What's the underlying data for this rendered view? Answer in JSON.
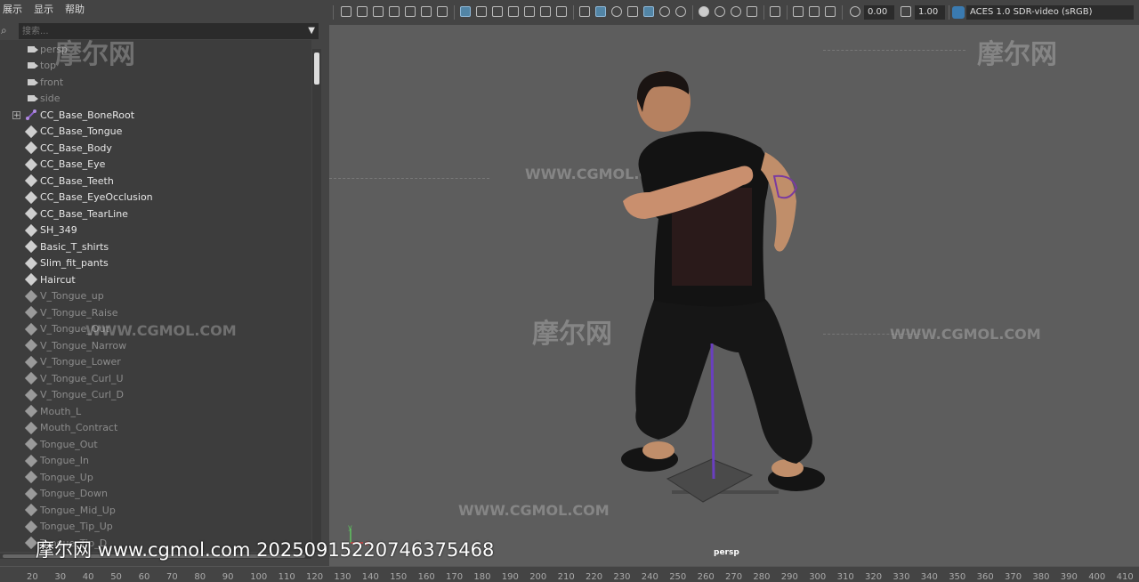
{
  "menu": {
    "items": [
      "展示",
      "显示",
      "帮助"
    ]
  },
  "outliner": {
    "search_placeholder": "搜索...",
    "items": [
      {
        "label": "persp",
        "kind": "camera",
        "style": "cam"
      },
      {
        "label": "top",
        "kind": "camera",
        "style": "cam"
      },
      {
        "label": "front",
        "kind": "camera",
        "style": "cam"
      },
      {
        "label": "side",
        "kind": "camera",
        "style": "cam"
      },
      {
        "label": "CC_Base_BoneRoot",
        "kind": "joint",
        "style": "active",
        "expandable": true
      },
      {
        "label": "CC_Base_Tongue",
        "kind": "mesh",
        "style": "active"
      },
      {
        "label": "CC_Base_Body",
        "kind": "mesh",
        "style": "active"
      },
      {
        "label": "CC_Base_Eye",
        "kind": "mesh",
        "style": "active"
      },
      {
        "label": "CC_Base_Teeth",
        "kind": "mesh",
        "style": "active"
      },
      {
        "label": "CC_Base_EyeOcclusion",
        "kind": "mesh",
        "style": "active"
      },
      {
        "label": "CC_Base_TearLine",
        "kind": "mesh",
        "style": "active"
      },
      {
        "label": "SH_349",
        "kind": "mesh",
        "style": "active"
      },
      {
        "label": "Basic_T_shirts",
        "kind": "mesh",
        "style": "active"
      },
      {
        "label": "Slim_fit_pants",
        "kind": "mesh",
        "style": "active"
      },
      {
        "label": "Haircut",
        "kind": "mesh",
        "style": "active"
      },
      {
        "label": "V_Tongue_up",
        "kind": "mesh",
        "style": "dim"
      },
      {
        "label": "V_Tongue_Raise",
        "kind": "mesh",
        "style": "dim"
      },
      {
        "label": "V_Tongue_Out",
        "kind": "mesh",
        "style": "dim"
      },
      {
        "label": "V_Tongue_Narrow",
        "kind": "mesh",
        "style": "dim"
      },
      {
        "label": "V_Tongue_Lower",
        "kind": "mesh",
        "style": "dim"
      },
      {
        "label": "V_Tongue_Curl_U",
        "kind": "mesh",
        "style": "dim"
      },
      {
        "label": "V_Tongue_Curl_D",
        "kind": "mesh",
        "style": "dim"
      },
      {
        "label": "Mouth_L",
        "kind": "mesh",
        "style": "dim"
      },
      {
        "label": "Mouth_Contract",
        "kind": "mesh",
        "style": "dim"
      },
      {
        "label": "Tongue_Out",
        "kind": "mesh",
        "style": "dim"
      },
      {
        "label": "Tongue_In",
        "kind": "mesh",
        "style": "dim"
      },
      {
        "label": "Tongue_Up",
        "kind": "mesh",
        "style": "dim"
      },
      {
        "label": "Tongue_Down",
        "kind": "mesh",
        "style": "dim"
      },
      {
        "label": "Tongue_Mid_Up",
        "kind": "mesh",
        "style": "dim"
      },
      {
        "label": "Tongue_Tip_Up",
        "kind": "mesh",
        "style": "dim"
      },
      {
        "label": "Tongue_Tip_D",
        "kind": "mesh",
        "style": "dim"
      }
    ]
  },
  "toolbar": {
    "exposure_value": "0.00",
    "gamma_value": "1.00",
    "color_space": "ACES 1.0 SDR-video (sRGB)"
  },
  "viewport": {
    "camera_label": "persp",
    "axis_y_label": "y",
    "axis_x_label": "x"
  },
  "watermark": {
    "logo_text": "摩尔网",
    "url_text": "WWW.CGMOL.COM",
    "caption": "摩尔网 www.cgmol.com 202509152207463754​68"
  },
  "timeline": {
    "ticks": [
      "20",
      "30",
      "40",
      "50",
      "60",
      "70",
      "80",
      "90",
      "100",
      "110",
      "120",
      "130",
      "140",
      "150",
      "160",
      "170",
      "180",
      "190",
      "200",
      "210",
      "220",
      "230",
      "240",
      "250",
      "260",
      "270",
      "280",
      "290",
      "300",
      "310",
      "320",
      "330",
      "340",
      "350",
      "360",
      "370",
      "380",
      "390",
      "400",
      "410"
    ]
  },
  "colors": {
    "viewport_bg": "#5d5d5d",
    "panel_bg": "#444444",
    "highlight": "#5285a6",
    "joint_purple": "#8a60c8"
  }
}
